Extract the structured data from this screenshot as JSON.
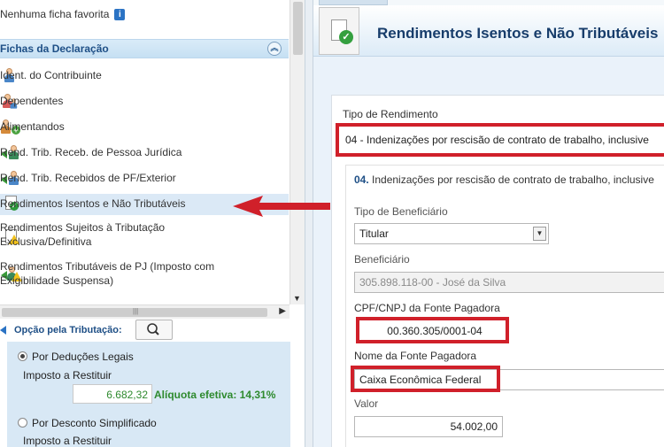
{
  "sidebar": {
    "favorite_text": "Nenhuma ficha favorita",
    "favorite_badge": "i",
    "section_title": "Fichas da Declaração",
    "items": [
      {
        "label": "Ident. do Contribuinte",
        "icon": "person-icon"
      },
      {
        "label": "Dependentes",
        "icon": "dependents-icon"
      },
      {
        "label": "Alimentandos",
        "icon": "alimentandos-icon"
      },
      {
        "label": "Rend. Trib. Receb. de Pessoa Jurídica",
        "icon": "income-arrow-icon"
      },
      {
        "label": "Rend. Trib. Recebidos de PF/Exterior",
        "icon": "income-arrow-icon"
      },
      {
        "label": "Rendimentos Isentos e Não Tributáveis",
        "icon": "document-check-icon",
        "selected": true
      },
      {
        "label_line1": "Rendimentos Sujeitos à Tributação",
        "label_line2": "Exclusiva/Definitiva",
        "icon": "document-warning-icon"
      },
      {
        "label_line1": "Rendimentos Tributáveis de PJ (Imposto com",
        "label_line2": "Exigibilidade Suspensa)",
        "icon": "income-warning-icon"
      }
    ]
  },
  "tax_option": {
    "label": "Opção pela Tributação:",
    "deducoes_label": "Por Deduções Legais",
    "imposto_label": "Imposto a Restituir",
    "imposto_value": "6.682,32",
    "aliquota": "Alíquota efetiva: 14,31%",
    "simplificado_label": "Por Desconto Simplificado",
    "imposto_label_2": "Imposto a Restituir"
  },
  "main": {
    "title": "Rendimentos Isentos e Não Tributáveis",
    "tipo_label": "Tipo de Rendimento",
    "tipo_value": "04 - Indenizações por rescisão de contrato de trabalho, inclusive",
    "subheader_num": "04.",
    "subheader_text": " Indenizações por rescisão de contrato de trabalho, inclusive",
    "tipo_benef_label": "Tipo de Beneficiário",
    "tipo_benef_value": "Titular",
    "beneficiario_label": "Beneficiário",
    "beneficiario_value": "305.898.118-00 - José da Silva",
    "cnpj_label": "CPF/CNPJ da Fonte Pagadora",
    "cnpj_value": "00.360.305/0001-04",
    "nome_label": "Nome da Fonte Pagadora",
    "nome_value": "Caixa Econômica Federal",
    "valor_label": "Valor",
    "valor_value": "54.002,00"
  },
  "colors": {
    "highlight_red": "#d0202a",
    "header_blue": "#1e4f86",
    "green_value": "#2e8a2e"
  }
}
